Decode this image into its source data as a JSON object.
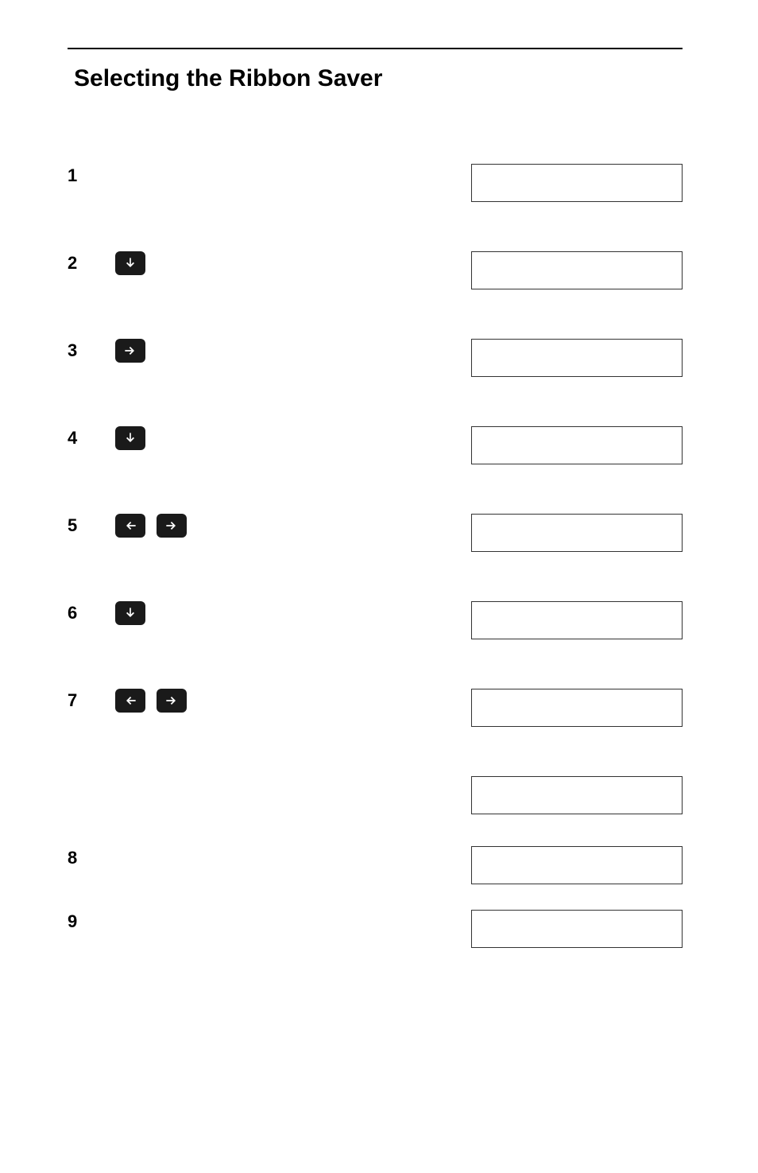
{
  "title": "Selecting the Ribbon Saver",
  "steps": [
    {
      "number": "1",
      "buttons": [],
      "displays": 1
    },
    {
      "number": "2",
      "buttons": [
        "down"
      ],
      "displays": 1
    },
    {
      "number": "3",
      "buttons": [
        "right"
      ],
      "displays": 1
    },
    {
      "number": "4",
      "buttons": [
        "down"
      ],
      "displays": 1
    },
    {
      "number": "5",
      "buttons": [
        "left",
        "right"
      ],
      "displays": 1
    },
    {
      "number": "6",
      "buttons": [
        "down"
      ],
      "displays": 1
    },
    {
      "number": "7",
      "buttons": [
        "left",
        "right"
      ],
      "displays": 2
    },
    {
      "number": "8",
      "buttons": [],
      "displays": 1
    },
    {
      "number": "9",
      "buttons": [],
      "displays": 1
    }
  ]
}
